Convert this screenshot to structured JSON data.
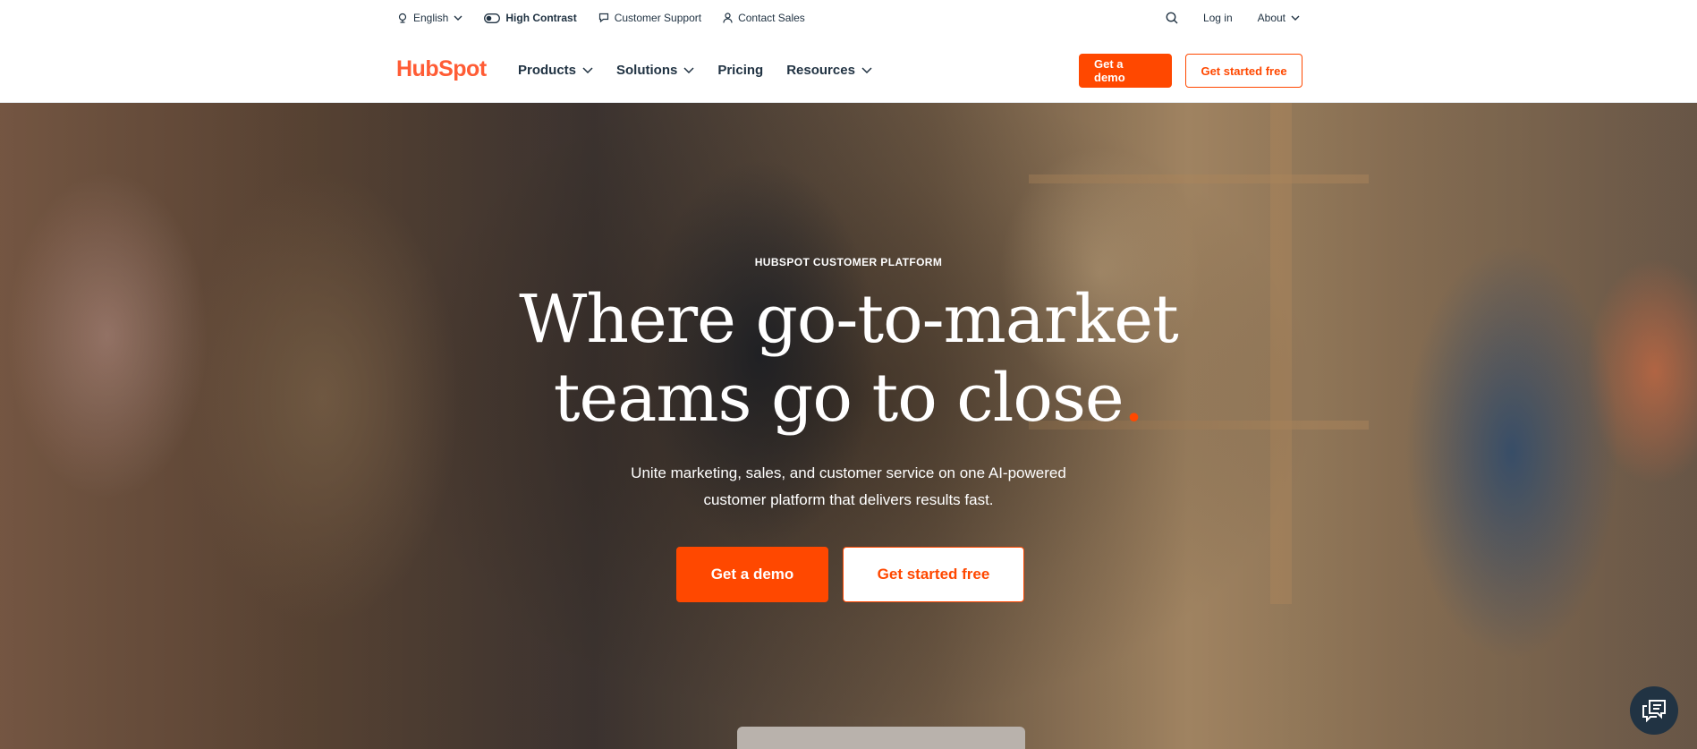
{
  "utility": {
    "language": "English",
    "high_contrast": "High Contrast",
    "customer_support": "Customer Support",
    "contact_sales": "Contact Sales",
    "log_in": "Log in",
    "about": "About"
  },
  "nav": {
    "logo_text": "HubSpot",
    "items": [
      {
        "label": "Products",
        "dropdown": true
      },
      {
        "label": "Solutions",
        "dropdown": true
      },
      {
        "label": "Pricing",
        "dropdown": false
      },
      {
        "label": "Resources",
        "dropdown": true
      }
    ],
    "demo_label": "Get a demo",
    "free_label": "Get started free"
  },
  "hero": {
    "eyebrow": "HUBSPOT CUSTOMER PLATFORM",
    "headline_line1": "Where go-to-market",
    "headline_line2": "teams go to close",
    "headline_dot": ".",
    "subhead_line1": "Unite marketing, sales, and customer service on one AI-powered",
    "subhead_line2": "customer platform that delivers results fast.",
    "demo_label": "Get a demo",
    "free_label": "Get started free"
  },
  "colors": {
    "accent": "#ff4800",
    "logo": "#ff5c35",
    "text": "#213343",
    "chat_bg": "#213343"
  },
  "icons": {
    "language": "globe-icon",
    "contrast": "toggle-icon",
    "support": "chat-bubble-icon",
    "sales": "person-icon",
    "search": "search-icon",
    "chat": "chat-icon"
  }
}
